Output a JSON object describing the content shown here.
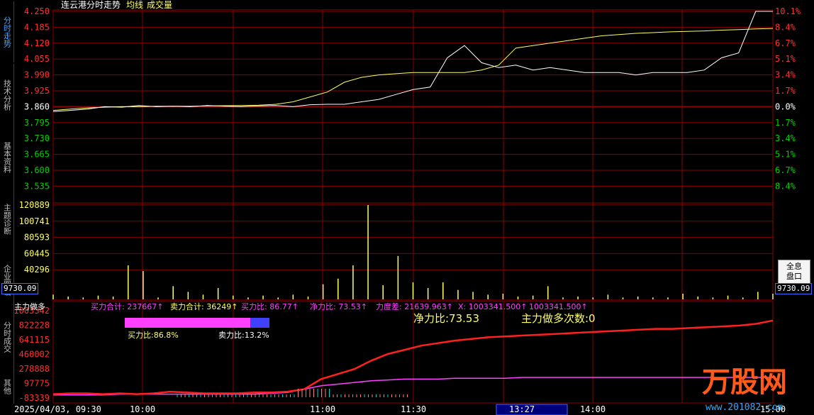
{
  "tabs": [
    {
      "label": "分时走势",
      "active": true
    },
    {
      "label": "技术分析",
      "active": false
    },
    {
      "label": "基本资料",
      "active": false
    },
    {
      "label": "主题诊断",
      "active": false
    },
    {
      "label": "企业图谱",
      "active": false
    },
    {
      "label": "分时成交",
      "active": false
    },
    {
      "label": "其他",
      "active": false
    }
  ],
  "header": {
    "title": "连云港分时走势",
    "avg_label": "均线",
    "vol_label": "成交量"
  },
  "price_panel": {
    "left_ticks": [
      "4.250",
      "4.185",
      "4.120",
      "4.055",
      "3.990",
      "3.925",
      "3.860",
      "3.795",
      "3.730",
      "3.665",
      "3.600",
      "3.535"
    ],
    "right_ticks": [
      "10.1%",
      "8.4%",
      "6.7%",
      "5.1%",
      "3.4%",
      "1.7%",
      "0.0%",
      "1.7%",
      "3.4%",
      "5.1%",
      "6.7%",
      "8.4%"
    ],
    "price_curve": [
      3.84,
      3.845,
      3.85,
      3.86,
      3.858,
      3.865,
      3.86,
      3.862,
      3.86,
      3.865,
      3.862,
      3.86,
      3.863,
      3.865,
      3.86,
      3.868,
      3.87,
      3.87,
      3.88,
      3.89,
      3.91,
      3.93,
      3.94,
      4.06,
      4.11,
      4.04,
      4.02,
      4.03,
      4.01,
      4.02,
      4.01,
      4.0,
      4.0,
      4.0,
      3.99,
      4.0,
      4.0,
      4.0,
      4.01,
      4.06,
      4.08,
      4.25,
      4.25
    ],
    "avg_curve": [
      3.845,
      3.85,
      3.855,
      3.858,
      3.86,
      3.86,
      3.862,
      3.862,
      3.862,
      3.863,
      3.864,
      3.865,
      3.866,
      3.87,
      3.88,
      3.9,
      3.92,
      3.96,
      3.98,
      3.99,
      3.995,
      4.0,
      4.0,
      4.0,
      4.0,
      4.01,
      4.03,
      4.1,
      4.11,
      4.12,
      4.13,
      4.14,
      4.15,
      4.155,
      4.16,
      4.163,
      4.166,
      4.168,
      4.17,
      4.173,
      4.175,
      4.178,
      4.18
    ]
  },
  "volume_panel": {
    "ticks": [
      "120889",
      "100741",
      "80593",
      "60445",
      "40296"
    ],
    "current": "9730.09",
    "bars": [
      0.05,
      0.03,
      0.02,
      0.04,
      0.03,
      0.36,
      0.3,
      0.02,
      0.14,
      0.08,
      0.05,
      0.12,
      0.04,
      0.02,
      0.04,
      0.02,
      0.05,
      0.03,
      0.16,
      0.22,
      0.36,
      1.0,
      0.15,
      0.46,
      0.18,
      0.12,
      0.18,
      0.1,
      0.08,
      0.05,
      0.06,
      0.03,
      0.04,
      0.14,
      0.02,
      0.03,
      0.02,
      0.05,
      0.02,
      0.03,
      0.02,
      0.02,
      0.06,
      0.03,
      0.02,
      0.04,
      0.02,
      0.08,
      0.06
    ]
  },
  "side_button": {
    "line1": "全息",
    "line2": "盘口"
  },
  "indicator": {
    "name": "主力做多",
    "buy_total": "买力合计: 237667↑",
    "sell_total": "卖力合计: 36249↑",
    "buy_ratio": "买力比: 86.77↑",
    "net_ratio": "净力比: 73.53↑",
    "strength": "力度差: 21639.963↑",
    "x_value": "X: 1003341.500↑",
    "x_value2": "1003341.500↑",
    "net_ratio_big": "净力比:73.53",
    "main_count": "主力做多次数:0",
    "buy_pct": "买力比:86.8%",
    "sell_pct": "卖力比:13.2%",
    "ticks": [
      "1003342",
      "822228",
      "641115",
      "460002",
      "278888",
      "97775",
      "-83339"
    ],
    "current": "9730.09",
    "red_curve": [
      0.02,
      0.03,
      0.03,
      0.02,
      0.03,
      0.02,
      0.03,
      0.05,
      0.04,
      0.03,
      0.03,
      0.03,
      0.04,
      0.04,
      0.05,
      0.08,
      0.2,
      0.26,
      0.32,
      0.42,
      0.5,
      0.55,
      0.6,
      0.63,
      0.66,
      0.68,
      0.7,
      0.71,
      0.72,
      0.73,
      0.74,
      0.75,
      0.76,
      0.77,
      0.78,
      0.79,
      0.8,
      0.8,
      0.81,
      0.82,
      0.83,
      0.84,
      0.86,
      0.9
    ],
    "magenta_curve": [
      0.01,
      0.01,
      0.01,
      0.01,
      0.02,
      0.02,
      0.02,
      0.02,
      0.02,
      0.02,
      0.02,
      0.02,
      0.02,
      0.03,
      0.04,
      0.08,
      0.12,
      0.14,
      0.16,
      0.18,
      0.19,
      0.2,
      0.2,
      0.2,
      0.21,
      0.21,
      0.21,
      0.21,
      0.22,
      0.22,
      0.22,
      0.22,
      0.22,
      0.22,
      0.22,
      0.22,
      0.22,
      0.22,
      0.22,
      0.22,
      0.22,
      0.22,
      0.22,
      0.22
    ]
  },
  "time_axis": {
    "date": "2025/04/03, 09:30",
    "labels": [
      "10:00",
      "11:00",
      "11:30",
      "14:00",
      "15:00"
    ],
    "cursor": "13:27"
  },
  "watermark": {
    "brand": "万股网",
    "url": "www.201082.com"
  },
  "colors": {
    "up": "#ff3030",
    "down": "#00d000",
    "grid": "#8b0000",
    "price": "#ffffff",
    "avg": "#ffff66",
    "volume": "#ffff66",
    "indicator_red": "#ff2020",
    "indicator_magenta": "#ff40ff",
    "accent": "#4aa3ff"
  }
}
